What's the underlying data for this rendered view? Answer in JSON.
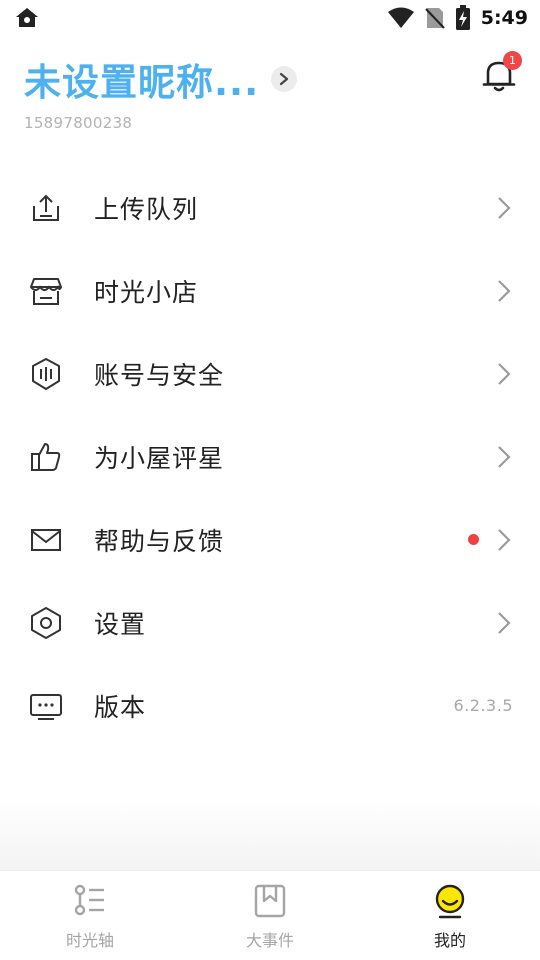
{
  "status_bar": {
    "time": "5:49"
  },
  "profile": {
    "nickname": "未设置昵称...",
    "phone": "15897800238",
    "notification_count": "1"
  },
  "menu": {
    "items": [
      {
        "label": "上传队列",
        "icon": "upload-icon"
      },
      {
        "label": "时光小店",
        "icon": "store-icon"
      },
      {
        "label": "账号与安全",
        "icon": "shield-icon"
      },
      {
        "label": "为小屋评星",
        "icon": "thumbs-up-icon"
      },
      {
        "label": "帮助与反馈",
        "icon": "mail-icon",
        "has_dot": true
      },
      {
        "label": "设置",
        "icon": "hexagon-settings-icon"
      },
      {
        "label": "版本",
        "icon": "monitor-icon",
        "value": "6.2.3.5"
      }
    ]
  },
  "bottom_nav": {
    "tabs": [
      {
        "label": "时光轴",
        "icon": "timeline-icon",
        "active": false
      },
      {
        "label": "大事件",
        "icon": "bookmark-icon",
        "active": false
      },
      {
        "label": "我的",
        "icon": "smiley-icon",
        "active": true
      }
    ]
  },
  "colors": {
    "accent": "#4db1ef",
    "badge": "#f04646",
    "active_tab_yellow": "#ffe600"
  }
}
